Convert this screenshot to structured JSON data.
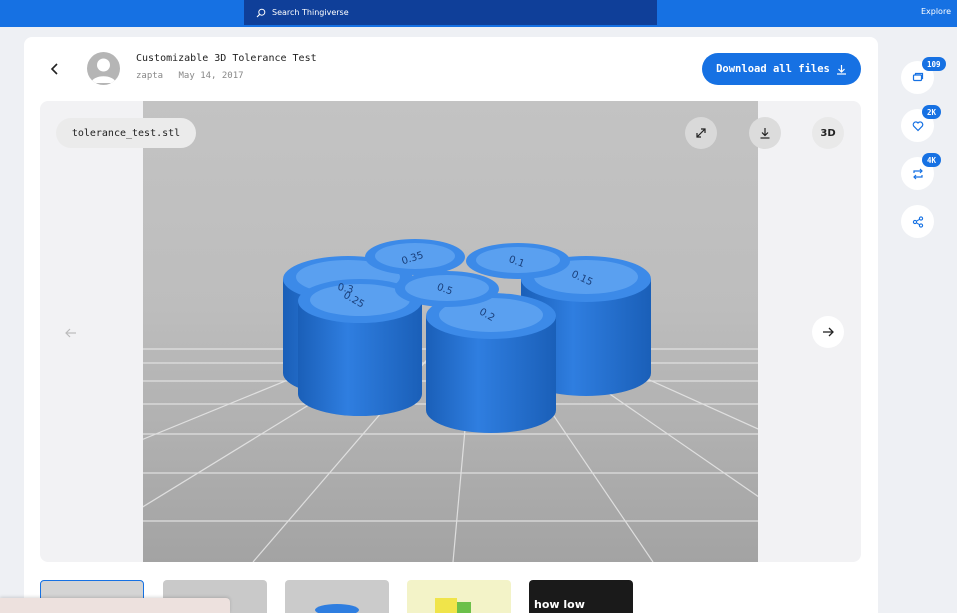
{
  "topbar": {
    "search_placeholder": "Search Thingiverse",
    "explore_label": "Explore"
  },
  "thing": {
    "title": "Customizable 3D Tolerance Test",
    "author": "zapta",
    "date": "May 14, 2017"
  },
  "actions": {
    "download_all_label": "Download all files"
  },
  "viewer": {
    "filename": "tolerance_test.stl",
    "three_d_label": "3D",
    "cylinder_labels": [
      "0.3",
      "0.35",
      "0.1",
      "0.5",
      "0.25",
      "0.2",
      "0.15"
    ]
  },
  "thumbnails": [
    {
      "caption": ""
    },
    {
      "caption": ""
    },
    {
      "caption": ""
    },
    {
      "caption": ""
    },
    {
      "caption": "how low"
    }
  ],
  "side_actions": {
    "comments_count": "109",
    "likes_count": "2K",
    "remixes_count": "4K"
  },
  "colors": {
    "accent": "#1671e3",
    "search_bg": "#0f3f99",
    "model_blue": "#2f7ee0"
  },
  "icons": [
    "search-icon",
    "back-arrow-icon",
    "avatar-icon",
    "download-icon",
    "expand-icon",
    "prev-arrow-icon",
    "next-arrow-icon",
    "comment-icon",
    "heart-icon",
    "remix-icon",
    "share-icon"
  ]
}
